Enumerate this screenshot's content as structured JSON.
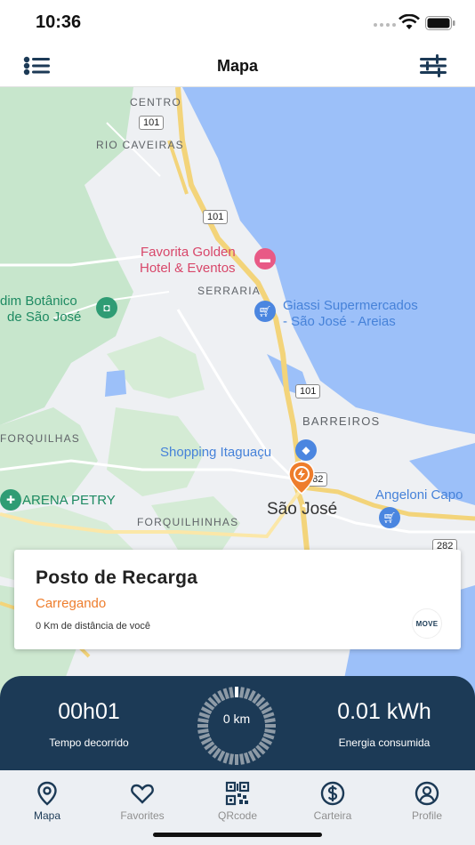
{
  "status_bar": {
    "time": "10:36"
  },
  "header": {
    "title": "Mapa"
  },
  "map": {
    "labels": {
      "centro": "CENTRO",
      "rio_caveiras": "RIO CAVEIRAS",
      "serraria": "SERRARIA",
      "barreiros": "BARREIROS",
      "forquilhas": "FORQUILHAS",
      "forquilhinhas": "FORQUILHINHAS",
      "sao_jose": "São José"
    },
    "road_shields": [
      "101",
      "101",
      "101",
      "282",
      "282"
    ],
    "pois": {
      "hotel_line1": "Favorita Golden",
      "hotel_line2": "Hotel & Eventos",
      "giassi_line1": "Giassi Supermercados",
      "giassi_line2": "- São José - Areias",
      "jardim_line1": "dim Botânico",
      "jardim_line2": "de São José",
      "shopping": "Shopping Itaguaçu",
      "arena": "ARENA PETRY",
      "angeloni": "Angeloni Capo"
    }
  },
  "station_card": {
    "name": "Posto de Recarga",
    "status": "Carregando",
    "distance": "0 Km de distância de você",
    "brand": "MOVE"
  },
  "session": {
    "elapsed_value": "00h01",
    "elapsed_label": "Tempo decorrido",
    "gauge_text": "0 km",
    "energy_value": "0.01 kWh",
    "energy_label": "Energia consumida",
    "gauge_progress": 0.02
  },
  "tabs": [
    {
      "label": "Mapa",
      "icon": "map-pin-icon",
      "active": true
    },
    {
      "label": "Favorites",
      "icon": "heart-icon",
      "active": false
    },
    {
      "label": "QRcode",
      "icon": "qrcode-icon",
      "active": false
    },
    {
      "label": "Carteira",
      "icon": "dollar-icon",
      "active": false
    },
    {
      "label": "Profile",
      "icon": "user-icon",
      "active": false
    }
  ],
  "colors": {
    "primary": "#1c3a56",
    "accent": "#ee7d2c",
    "water": "#9cc0f9",
    "park": "#bfe3c5"
  }
}
